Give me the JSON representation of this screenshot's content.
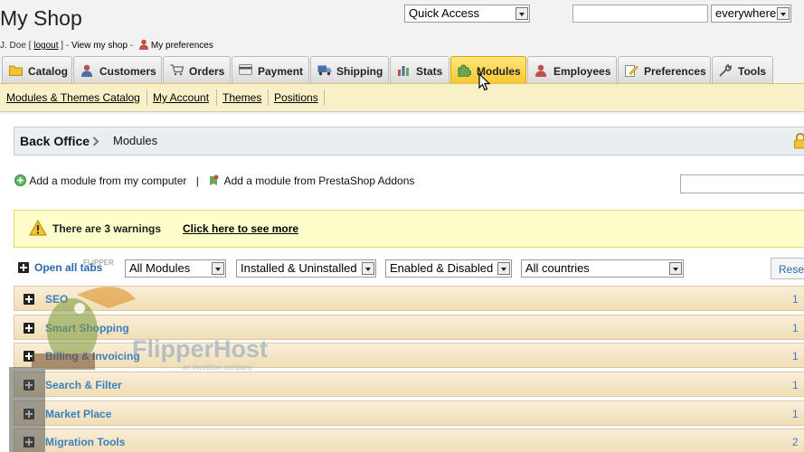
{
  "header": {
    "shop_title": "My Shop",
    "user": "J. Doe",
    "logout": "logout",
    "view_shop": "View my shop",
    "preferences": "My preferences",
    "quick_access": "Quick Access",
    "search_scope": "everywhere"
  },
  "tabs": [
    {
      "label": "Catalog",
      "icon": "folder-icon"
    },
    {
      "label": "Customers",
      "icon": "person-icon"
    },
    {
      "label": "Orders",
      "icon": "cart-icon"
    },
    {
      "label": "Payment",
      "icon": "card-icon"
    },
    {
      "label": "Shipping",
      "icon": "truck-icon"
    },
    {
      "label": "Stats",
      "icon": "bar-chart-icon"
    },
    {
      "label": "Modules",
      "icon": "puzzle-icon",
      "active": true
    },
    {
      "label": "Employees",
      "icon": "person-icon"
    },
    {
      "label": "Preferences",
      "icon": "pencil-paper-icon"
    },
    {
      "label": "Tools",
      "icon": "wrench-icon"
    }
  ],
  "subnav": [
    "Modules & Themes Catalog",
    "My Account",
    "Themes",
    "Positions"
  ],
  "breadcrumb": {
    "root": "Back Office",
    "current": "Modules"
  },
  "add_links": {
    "from_computer": "Add a module from my computer",
    "separator": "|",
    "from_addons": "Add a module from PrestaShop Addons"
  },
  "warning": {
    "text": "There are 3 warnings",
    "link": "Click here to see more"
  },
  "filters": {
    "open_all": "Open all tabs",
    "modules": "All Modules",
    "install": "Installed & Uninstalled",
    "status": "Enabled & Disabled",
    "country": "All countries",
    "reset": "Reset"
  },
  "categories": [
    {
      "name": "SEO",
      "count": "1"
    },
    {
      "name": "Smart Shopping",
      "count": "1"
    },
    {
      "name": "Billing & Invoicing",
      "count": "1"
    },
    {
      "name": "Search & Filter",
      "count": "1"
    },
    {
      "name": "Market Place",
      "count": "1"
    },
    {
      "name": "Migration Tools",
      "count": "2"
    }
  ],
  "watermark": {
    "brand": "FlipperHost",
    "tagline": "an investion company",
    "badge": "FLIPPER"
  },
  "colors": {
    "accent": "#f7c72f",
    "link": "#3c7fc0",
    "warning_bg": "#ffffcc",
    "category_bg": "#f1deb5"
  }
}
